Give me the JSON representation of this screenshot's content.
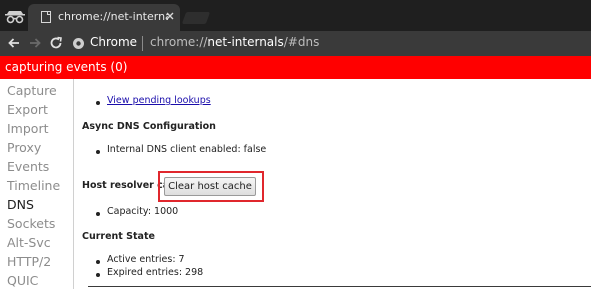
{
  "browser": {
    "tab": {
      "title": "chrome://net-internals/#"
    },
    "omnibox": {
      "origin_label": "Chrome",
      "url_scheme": "chrome://",
      "url_host": "net-internals",
      "url_path": "/#dns"
    }
  },
  "status": {
    "text": "capturing events (0)",
    "color": "#ff0000"
  },
  "sidebar": {
    "items": [
      {
        "label": "Capture"
      },
      {
        "label": "Export"
      },
      {
        "label": "Import"
      },
      {
        "label": "Proxy"
      },
      {
        "label": "Events"
      },
      {
        "label": "Timeline"
      },
      {
        "label": "DNS",
        "active": true
      },
      {
        "label": "Sockets"
      },
      {
        "label": "Alt-Svc"
      },
      {
        "label": "HTTP/2"
      },
      {
        "label": "QUIC"
      }
    ]
  },
  "dns": {
    "pending_lookups_link": "View pending lookups",
    "async_heading": "Async DNS Configuration",
    "internal_client": "Internal DNS client enabled: false",
    "host_resolver_label": "Host resolver cache",
    "clear_button": "Clear host cache",
    "capacity": "Capacity: 1000",
    "current_state_heading": "Current State",
    "active_entries": "Active entries: 7",
    "expired_entries": "Expired entries: 298"
  },
  "icons": {
    "incognito": "incognito-icon",
    "favicon": "chrome-page-icon",
    "tab_close": "close-icon",
    "back": "back-arrow-icon",
    "forward": "forward-arrow-icon",
    "reload": "reload-icon",
    "omnibox": "chrome-lock-icon"
  },
  "colors": {
    "highlight": "#e0272d",
    "link": "#1a0dab"
  }
}
